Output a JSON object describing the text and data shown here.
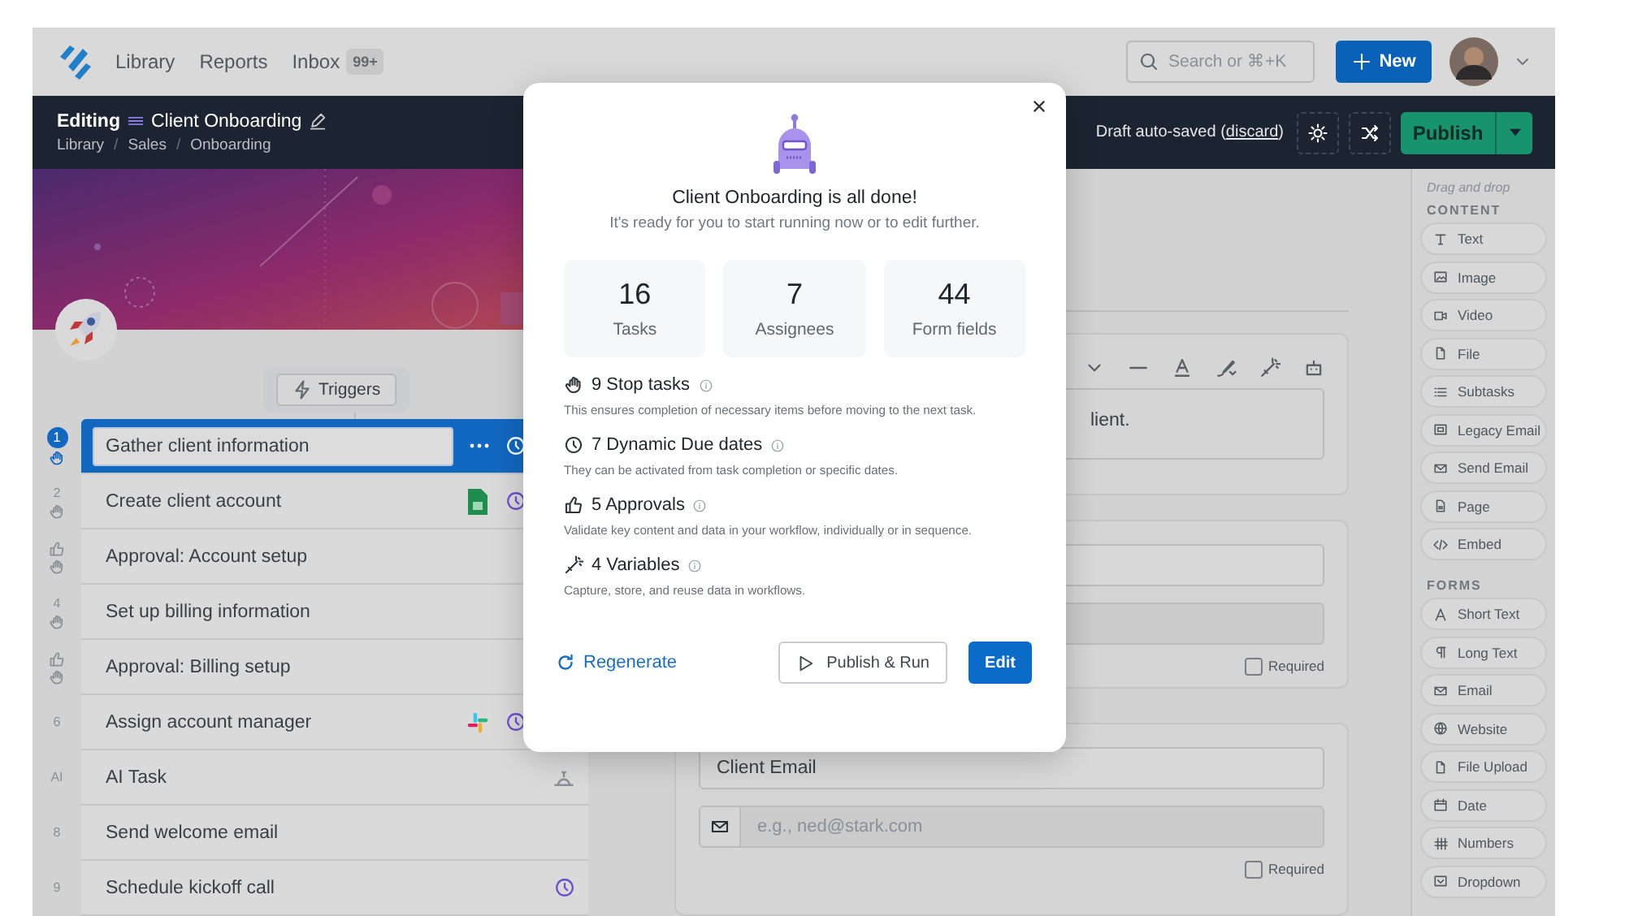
{
  "nav": {
    "links": [
      {
        "label": "Library"
      },
      {
        "label": "Reports"
      },
      {
        "label": "Inbox"
      }
    ],
    "inbox_badge": "99+",
    "search": {
      "placeholder": "Search or ⌘+K"
    },
    "new_button": "New"
  },
  "editor": {
    "mode": "Editing",
    "title": "Client Onboarding",
    "breadcrumbs": [
      "Library",
      "Sales",
      "Onboarding"
    ],
    "breadcrumb_separator": "/",
    "draft_status": {
      "before": "Draft auto-saved (",
      "link": "discard",
      "after": ")"
    },
    "publish": "Publish"
  },
  "triggers": "Triggers",
  "tasks": [
    {
      "kind": "step",
      "marker": "1",
      "stop": true,
      "title": "Gather client information",
      "selected": true,
      "menu": true,
      "due": true
    },
    {
      "kind": "step",
      "marker": "2",
      "stop": true,
      "title": "Create client account",
      "selected": false,
      "menu": false,
      "integration": {
        "kind": "sheet"
      },
      "due": true
    },
    {
      "kind": "approval",
      "stop": true,
      "title": "Approval: Account setup",
      "selected": false,
      "menu": false,
      "due": false
    },
    {
      "kind": "step",
      "marker": "4",
      "stop": true,
      "title": "Set up billing information",
      "selected": false,
      "menu": false,
      "due": false
    },
    {
      "kind": "approval",
      "stop": true,
      "title": "Approval: Billing setup",
      "selected": false,
      "menu": false,
      "due": false
    },
    {
      "kind": "step",
      "marker": "6",
      "stop": false,
      "title": "Assign account manager",
      "selected": false,
      "menu": false,
      "integration": {
        "kind": "slack"
      },
      "due": true
    },
    {
      "kind": "step",
      "marker": "AI",
      "stop": false,
      "title": "AI Task",
      "selected": false,
      "menu": false,
      "integration": {
        "kind": "bell"
      },
      "due": false
    },
    {
      "kind": "step",
      "marker": "8",
      "stop": false,
      "title": "Send welcome email",
      "selected": false,
      "menu": false,
      "due": false
    },
    {
      "kind": "step",
      "marker": "9",
      "stop": false,
      "title": "Schedule kickoff call",
      "selected": false,
      "menu": false,
      "due": true
    }
  ],
  "form": {
    "description_text": "lient.",
    "email_field_value": "Client Email",
    "email_placeholder": "e.g., ned@stark.com",
    "required": [
      {
        "label": "Required",
        "checked": false
      },
      {
        "label": "Required",
        "checked": false
      }
    ]
  },
  "sidebar": {
    "hint": "Drag and drop",
    "sections": [
      {
        "title": "CONTENT",
        "items": [
          {
            "label": "Text"
          },
          {
            "label": "Image"
          },
          {
            "label": "Video"
          },
          {
            "label": "File"
          },
          {
            "label": "Subtasks"
          },
          {
            "label": "Legacy Email"
          },
          {
            "label": "Send Email"
          },
          {
            "label": "Page"
          },
          {
            "label": "Embed"
          }
        ]
      },
      {
        "title": "FORMS",
        "items": [
          {
            "label": "Short Text"
          },
          {
            "label": "Long Text"
          },
          {
            "label": "Email"
          },
          {
            "label": "Website"
          },
          {
            "label": "File Upload"
          },
          {
            "label": "Date"
          },
          {
            "label": "Numbers"
          },
          {
            "label": "Dropdown"
          }
        ]
      }
    ]
  },
  "modal": {
    "title": "Client Onboarding is all done!",
    "subtitle": "It's ready for you to start running now or to edit further.",
    "stats": [
      {
        "value": "16",
        "label": "Tasks"
      },
      {
        "value": "7",
        "label": "Assignees"
      },
      {
        "value": "44",
        "label": "Form fields"
      }
    ],
    "features": [
      {
        "title": "9 Stop tasks",
        "description": "This ensures completion of necessary items before moving to the next task."
      },
      {
        "title": "7 Dynamic Due dates",
        "description": "They can be activated from task completion or specific dates."
      },
      {
        "title": "5 Approvals",
        "description": "Validate key content and data in your workflow, individually or in sequence."
      },
      {
        "title": "4 Variables",
        "description": "Capture, store, and reuse data in workflows."
      }
    ],
    "regenerate": "Regenerate",
    "publish_run": "Publish & Run",
    "edit": "Edit"
  }
}
